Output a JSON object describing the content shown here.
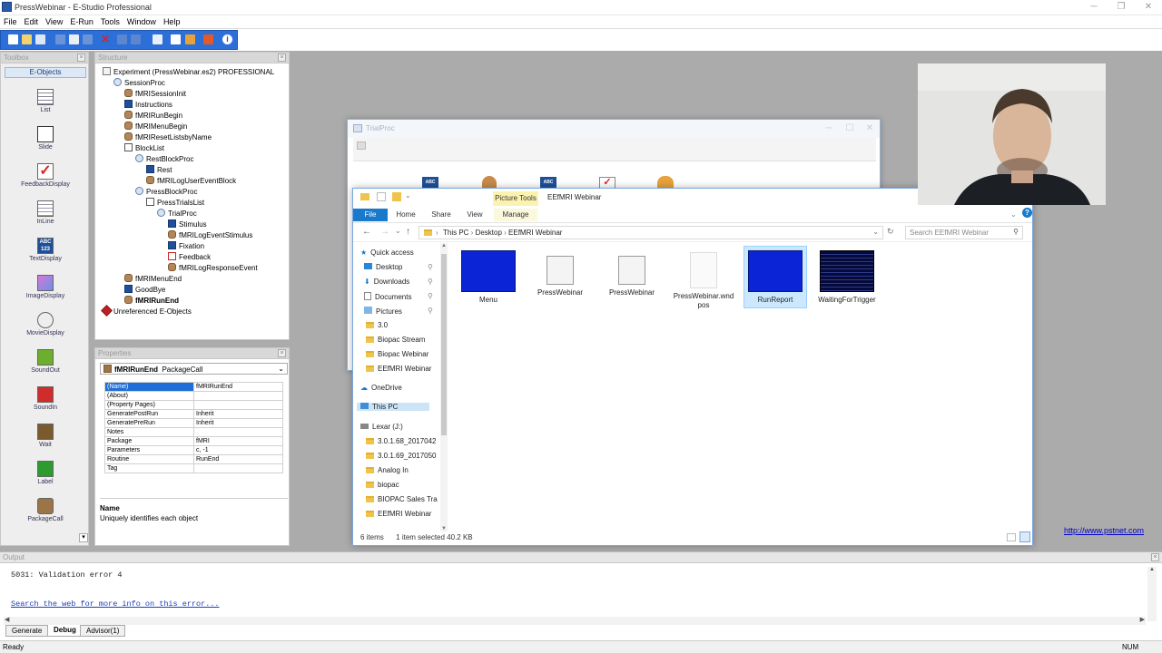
{
  "app": {
    "title": "PressWebinar - E-Studio Professional"
  },
  "menu": [
    "File",
    "Edit",
    "View",
    "E-Run",
    "Tools",
    "Window",
    "Help"
  ],
  "toolbox": {
    "title": "Toolbox",
    "header": "E-Objects",
    "items": [
      "List",
      "Slide",
      "FeedbackDisplay",
      "InLine",
      "TextDisplay",
      "ImageDisplay",
      "MovieDisplay",
      "SoundOut",
      "SoundIn",
      "Wait",
      "Label",
      "PackageCall"
    ],
    "icon_labels": [
      "ABC",
      "123"
    ]
  },
  "structure": {
    "title": "Structure",
    "nodes": [
      {
        "label": "Experiment (PressWebinar.es2) PROFESSIONAL",
        "depth": 0,
        "icon": "experiment-icon"
      },
      {
        "label": "SessionProc",
        "depth": 1,
        "icon": "procedure-icon"
      },
      {
        "label": "fMRISessionInit",
        "depth": 2,
        "icon": "package-icon"
      },
      {
        "label": "Instructions",
        "depth": 2,
        "icon": "textdisplay-icon"
      },
      {
        "label": "fMRIRunBegin",
        "depth": 2,
        "icon": "package-icon"
      },
      {
        "label": "fMRIMenuBegin",
        "depth": 2,
        "icon": "package-icon"
      },
      {
        "label": "fMRIResetListsbyName",
        "depth": 2,
        "icon": "package-icon"
      },
      {
        "label": "BlockList",
        "depth": 2,
        "icon": "list-icon"
      },
      {
        "label": "RestBlockProc",
        "depth": 3,
        "icon": "procedure-icon"
      },
      {
        "label": "Rest",
        "depth": 4,
        "icon": "textdisplay-icon"
      },
      {
        "label": "fMRILogUserEventBlock",
        "depth": 4,
        "icon": "package-icon"
      },
      {
        "label": "PressBlockProc",
        "depth": 3,
        "icon": "procedure-icon"
      },
      {
        "label": "PressTrialsList",
        "depth": 4,
        "icon": "list-icon"
      },
      {
        "label": "TrialProc",
        "depth": 5,
        "icon": "procedure-icon"
      },
      {
        "label": "Stimulus",
        "depth": 6,
        "icon": "textdisplay-icon"
      },
      {
        "label": "fMRILogEventStimulus",
        "depth": 6,
        "icon": "package-icon"
      },
      {
        "label": "Fixation",
        "depth": 6,
        "icon": "textdisplay-icon"
      },
      {
        "label": "Feedback",
        "depth": 6,
        "icon": "feedback-icon"
      },
      {
        "label": "fMRILogResponseEvent",
        "depth": 6,
        "icon": "package-icon"
      },
      {
        "label": "fMRIMenuEnd",
        "depth": 2,
        "icon": "package-icon"
      },
      {
        "label": "GoodBye",
        "depth": 2,
        "icon": "textdisplay-icon"
      },
      {
        "label": "fMRIRunEnd",
        "depth": 2,
        "icon": "package-icon",
        "bold": true
      },
      {
        "label": "Unreferenced E-Objects",
        "depth": 0,
        "icon": "unreferenced-icon"
      }
    ]
  },
  "properties": {
    "title": "Properties",
    "selected_object": "fMRIRunEnd",
    "selected_type": "PackageCall",
    "rows": [
      [
        "(Name)",
        "fMRIRunEnd"
      ],
      [
        "(About)",
        ""
      ],
      [
        "(Property Pages)",
        ""
      ],
      [
        "GeneratePostRun",
        "Inherit"
      ],
      [
        "GeneratePreRun",
        "Inherit"
      ],
      [
        "Notes",
        ""
      ],
      [
        "Package",
        "fMRI"
      ],
      [
        "Parameters",
        "c, -1"
      ],
      [
        "Routine",
        "RunEnd"
      ],
      [
        "Tag",
        ""
      ]
    ],
    "desc_title": "Name",
    "desc_text": "Uniquely identifies each object"
  },
  "trialproc": {
    "title": "TrialProc",
    "icon_label": "ABC"
  },
  "explorer": {
    "title": "EEfMRI Webinar",
    "context_tab": "Picture Tools",
    "tabs": [
      "File",
      "Home",
      "Share",
      "View",
      "Manage"
    ],
    "path": [
      "This PC",
      "Desktop",
      "EEfMRI Webinar"
    ],
    "search_placeholder": "Search EEfMRI Webinar",
    "nav": [
      {
        "label": "Quick access",
        "type": "star"
      },
      {
        "label": "Desktop",
        "type": "desktop",
        "pin": true
      },
      {
        "label": "Downloads",
        "type": "download",
        "pin": true
      },
      {
        "label": "Documents",
        "type": "doc",
        "pin": true
      },
      {
        "label": "Pictures",
        "type": "pic",
        "pin": true
      },
      {
        "label": "3.0",
        "type": "folder"
      },
      {
        "label": "Biopac Stream",
        "type": "folder"
      },
      {
        "label": "Biopac Webinar",
        "type": "folder"
      },
      {
        "label": "EEfMRI Webinar",
        "type": "folder"
      },
      {
        "label": "OneDrive",
        "type": "cloud"
      },
      {
        "label": "This PC",
        "type": "pc",
        "selected": true
      },
      {
        "label": "Lexar (J:)",
        "type": "drive"
      },
      {
        "label": "3.0.1.68_2017042",
        "type": "folder"
      },
      {
        "label": "3.0.1.69_2017050",
        "type": "folder"
      },
      {
        "label": "Analog In",
        "type": "folder"
      },
      {
        "label": "biopac",
        "type": "folder"
      },
      {
        "label": "BIOPAC Sales Tra",
        "type": "folder"
      },
      {
        "label": "EEfMRI Webinar",
        "type": "folder"
      }
    ],
    "files": [
      {
        "name": "Menu",
        "kind": "image-blue"
      },
      {
        "name": "PressWebinar",
        "kind": "es-file"
      },
      {
        "name": "PressWebinar",
        "kind": "ebs-file"
      },
      {
        "name": "PressWebinar.wndpos",
        "kind": "blank"
      },
      {
        "name": "RunReport",
        "kind": "image-blue",
        "selected": true
      },
      {
        "name": "WaitingForTrigger",
        "kind": "image-dark"
      }
    ],
    "status_count": "6 items",
    "status_selected": "1 item selected  40.2 KB"
  },
  "web_link": "http://www.pstnet.com",
  "output": {
    "title": "Output",
    "lines": [
      "5031: Validation error 4",
      "",
      "Search the web for more info on this error..."
    ],
    "tabs": [
      "Generate",
      "Debug",
      "Advisor(1)"
    ]
  },
  "statusbar": {
    "left": "Ready",
    "right": "NUM"
  }
}
